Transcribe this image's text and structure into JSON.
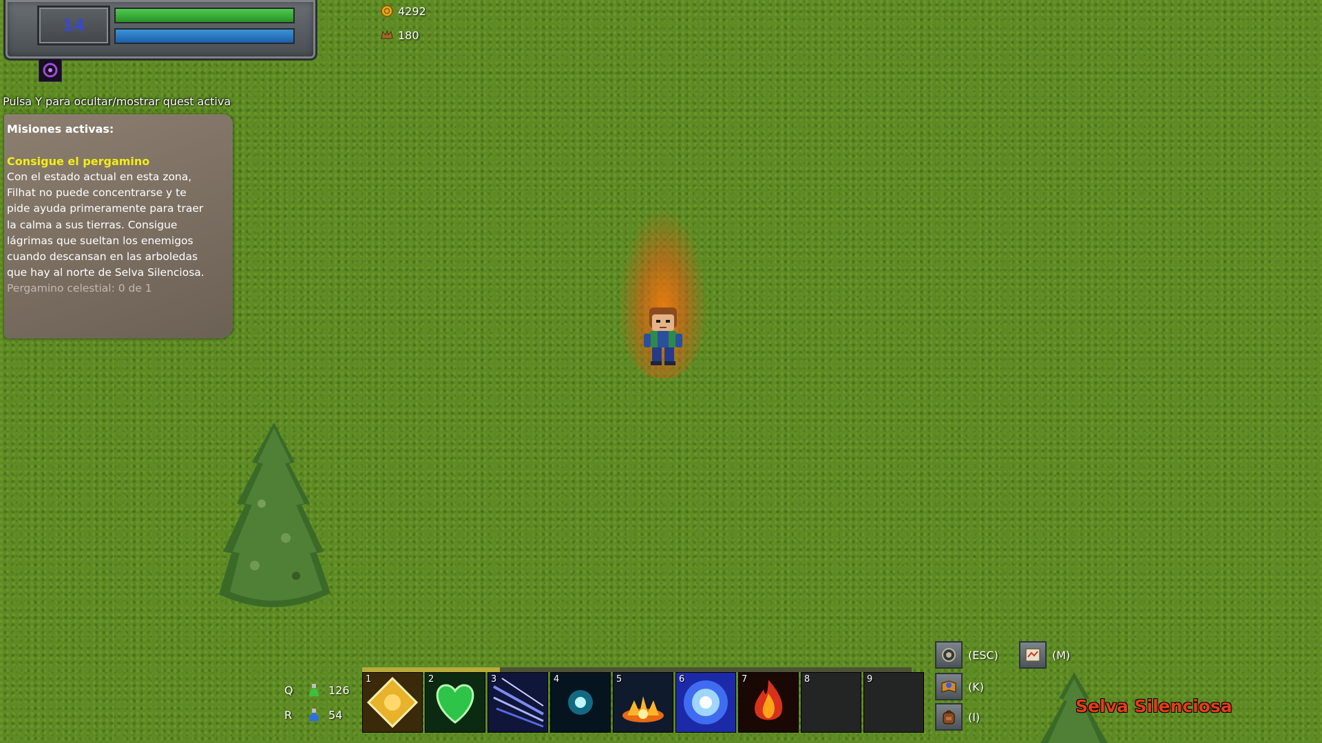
{
  "player": {
    "level": "14",
    "hp_fraction": 1.0,
    "mp_fraction": 1.0,
    "active_buff_icon": "shadow-swirl-icon"
  },
  "currencies": {
    "gold": {
      "value": "4292",
      "icon": "gold-coin-icon"
    },
    "honor": {
      "value": "180",
      "icon": "crown-icon"
    }
  },
  "quest_log": {
    "toggle_hint": "Pulsa Y para ocultar/mostrar quest activa",
    "panel_title": "Misiones activas:",
    "quests": [
      {
        "name": "Consigue el pergamino",
        "description": "Con el estado actual en esta zona,\nFilhat no puede concentrarse y te\npide ayuda primeramente para traer\nla calma a sus tierras. Consigue\nlágrimas que sueltan los enemigos\ncuando descansan en las arboledas\nque hay al norte de Selva Silenciosa.",
        "progress": "Pergamino celestial: 0 de 1"
      }
    ]
  },
  "potions": {
    "health": {
      "key": "Q",
      "count": "126",
      "icon": "green-potion-icon"
    },
    "mana": {
      "key": "R",
      "count": "54",
      "icon": "blue-potion-icon"
    }
  },
  "action_bar": {
    "xp_fraction": 0.25,
    "slots": [
      {
        "number": "1",
        "icon": "golden-diamond-icon",
        "empty": false
      },
      {
        "number": "2",
        "icon": "green-heart-icon",
        "empty": false
      },
      {
        "number": "3",
        "icon": "blue-slash-icon",
        "empty": false
      },
      {
        "number": "4",
        "icon": "cyan-orb-icon",
        "empty": false
      },
      {
        "number": "5",
        "icon": "fire-burst-icon",
        "empty": false
      },
      {
        "number": "6",
        "icon": "blue-light-orb-icon",
        "empty": false
      },
      {
        "number": "7",
        "icon": "flame-icon",
        "empty": false
      },
      {
        "number": "8",
        "icon": "",
        "empty": true
      },
      {
        "number": "9",
        "icon": "",
        "empty": true
      }
    ]
  },
  "menu_shortcuts": {
    "esc": {
      "label": "(ESC)",
      "icon": "options-gear-icon"
    },
    "map": {
      "label": "(M)",
      "icon": "map-icon"
    },
    "skills": {
      "label": "(K)",
      "icon": "spellbook-icon"
    },
    "inventory": {
      "label": "(I)",
      "icon": "backpack-icon"
    }
  },
  "zone": {
    "name": "Selva Silenciosa",
    "color": "#e83a1a"
  },
  "colors": {
    "hp": "#3bb33b",
    "mp": "#2779c6",
    "quest_title": "#f3ee14",
    "grass": "#5d8a24"
  }
}
